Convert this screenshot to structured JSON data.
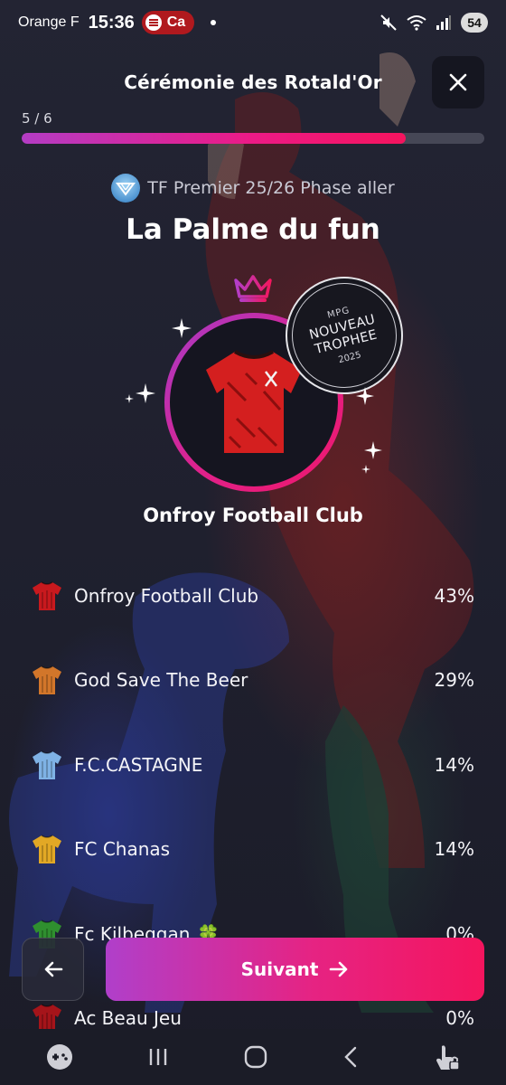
{
  "status_bar": {
    "carrier": "Orange F",
    "time": "15:36",
    "spotify_label": "Ca",
    "battery": "54"
  },
  "header": {
    "title": "Cérémonie des Rotald'Or"
  },
  "progress": {
    "label": "5 / 6",
    "fraction": 0.83
  },
  "league": {
    "name": "TF Premier 25/26 Phase aller"
  },
  "award": {
    "title": "La Palme du fun",
    "stamp": {
      "top": "MPG",
      "line1": "NOUVEAU",
      "line2": "TROPHEE",
      "year": "2025"
    },
    "winner": "Onfroy Football Club"
  },
  "results": [
    {
      "name": "Onfroy Football Club",
      "pct": "43%",
      "jersey": "red-x-jersey-icon",
      "color": "#c8191e"
    },
    {
      "name": "God Save The Beer",
      "pct": "29%",
      "jersey": "orange-striped-jersey-icon",
      "color": "#d2762a"
    },
    {
      "name": "F.C.CASTAGNE",
      "pct": "14%",
      "jersey": "blue-white-striped-jersey-icon",
      "color": "#7fb2e5"
    },
    {
      "name": "FC Chanas",
      "pct": "14%",
      "jersey": "yellow-jersey-icon",
      "color": "#e2a825"
    },
    {
      "name": "Fc Kilbeggan",
      "pct": "0%",
      "jersey": "green-jersey-icon",
      "color": "#2f8f2f",
      "emoji": "🍀"
    },
    {
      "name": "Ac Beau Jeu",
      "pct": "0%",
      "jersey": "red-black-jersey-icon",
      "color": "#a5141a"
    }
  ],
  "buttons": {
    "next_label": "Suivant"
  },
  "colors": {
    "accent_start": "#b03fca",
    "accent_end": "#f4155e",
    "background": "#1d1e2c"
  }
}
